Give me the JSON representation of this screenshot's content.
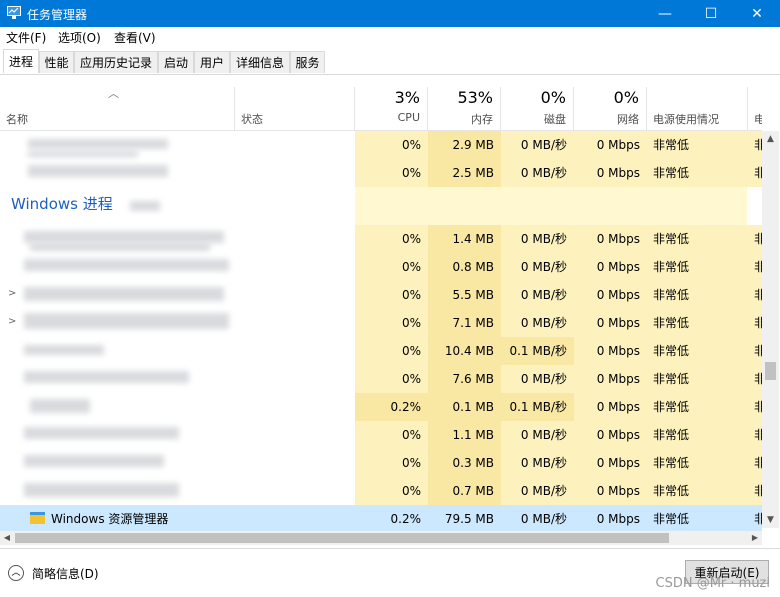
{
  "window": {
    "title": "任务管理器",
    "minimize": "—",
    "maximize": "☐",
    "close": "✕"
  },
  "menu": [
    {
      "label": "文件(F)"
    },
    {
      "label": "选项(O)"
    },
    {
      "label": "查看(V)"
    }
  ],
  "tabs": [
    {
      "label": "进程",
      "active": true
    },
    {
      "label": "性能"
    },
    {
      "label": "应用历史记录"
    },
    {
      "label": "启动"
    },
    {
      "label": "用户"
    },
    {
      "label": "详细信息"
    },
    {
      "label": "服务"
    }
  ],
  "columns": {
    "name": "名称",
    "status": "状态",
    "cpu": {
      "pct": "3%",
      "label": "CPU"
    },
    "memory": {
      "pct": "53%",
      "label": "内存"
    },
    "disk": {
      "pct": "0%",
      "label": "磁盘"
    },
    "network": {
      "pct": "0%",
      "label": "网络"
    },
    "power": "电源使用情况",
    "power_trend": "电源"
  },
  "group": {
    "title": "Windows 进程"
  },
  "rows": [
    {
      "cpu": "0%",
      "mem": "2.9 MB",
      "disk": "0 MB/秒",
      "net": "0 Mbps",
      "power": "非常低",
      "trend": "非"
    },
    {
      "cpu": "0%",
      "mem": "2.5 MB",
      "disk": "0 MB/秒",
      "net": "0 Mbps",
      "power": "非常低",
      "trend": "非"
    },
    {
      "cpu": "0%",
      "mem": "1.4 MB",
      "disk": "0 MB/秒",
      "net": "0 Mbps",
      "power": "非常低",
      "trend": "非"
    },
    {
      "cpu": "0%",
      "mem": "0.8 MB",
      "disk": "0 MB/秒",
      "net": "0 Mbps",
      "power": "非常低",
      "trend": "非"
    },
    {
      "cpu": "0%",
      "mem": "5.5 MB",
      "disk": "0 MB/秒",
      "net": "0 Mbps",
      "power": "非常低",
      "trend": "非"
    },
    {
      "cpu": "0%",
      "mem": "7.1 MB",
      "disk": "0 MB/秒",
      "net": "0 Mbps",
      "power": "非常低",
      "trend": "非"
    },
    {
      "cpu": "0%",
      "mem": "10.4 MB",
      "disk": "0.1 MB/秒",
      "net": "0 Mbps",
      "power": "非常低",
      "trend": "非"
    },
    {
      "cpu": "0%",
      "mem": "7.6 MB",
      "disk": "0 MB/秒",
      "net": "0 Mbps",
      "power": "非常低",
      "trend": "非"
    },
    {
      "cpu": "0.2%",
      "mem": "0.1 MB",
      "disk": "0.1 MB/秒",
      "net": "0 Mbps",
      "power": "非常低",
      "trend": "非"
    },
    {
      "cpu": "0%",
      "mem": "1.1 MB",
      "disk": "0 MB/秒",
      "net": "0 Mbps",
      "power": "非常低",
      "trend": "非"
    },
    {
      "cpu": "0%",
      "mem": "0.3 MB",
      "disk": "0 MB/秒",
      "net": "0 Mbps",
      "power": "非常低",
      "trend": "非"
    },
    {
      "cpu": "0%",
      "mem": "0.7 MB",
      "disk": "0 MB/秒",
      "net": "0 Mbps",
      "power": "非常低",
      "trend": "非"
    },
    {
      "name": "Windows 资源管理器",
      "cpu": "0.2%",
      "mem": "79.5 MB",
      "disk": "0 MB/秒",
      "net": "0 Mbps",
      "power": "非常低",
      "trend": "非",
      "selected": true
    }
  ],
  "footer": {
    "less_details": "简略信息(D)",
    "restart": "重新启动(E)",
    "watermark": "CSDN @Mr · muzi"
  },
  "colors": {
    "titlebar": "#0078d7",
    "heat_light": "#fff8d1",
    "heat": "#fdf2be",
    "heat_strong": "#f9e8a3",
    "selected": "#cce8ff",
    "group": "#1e5fc0"
  }
}
